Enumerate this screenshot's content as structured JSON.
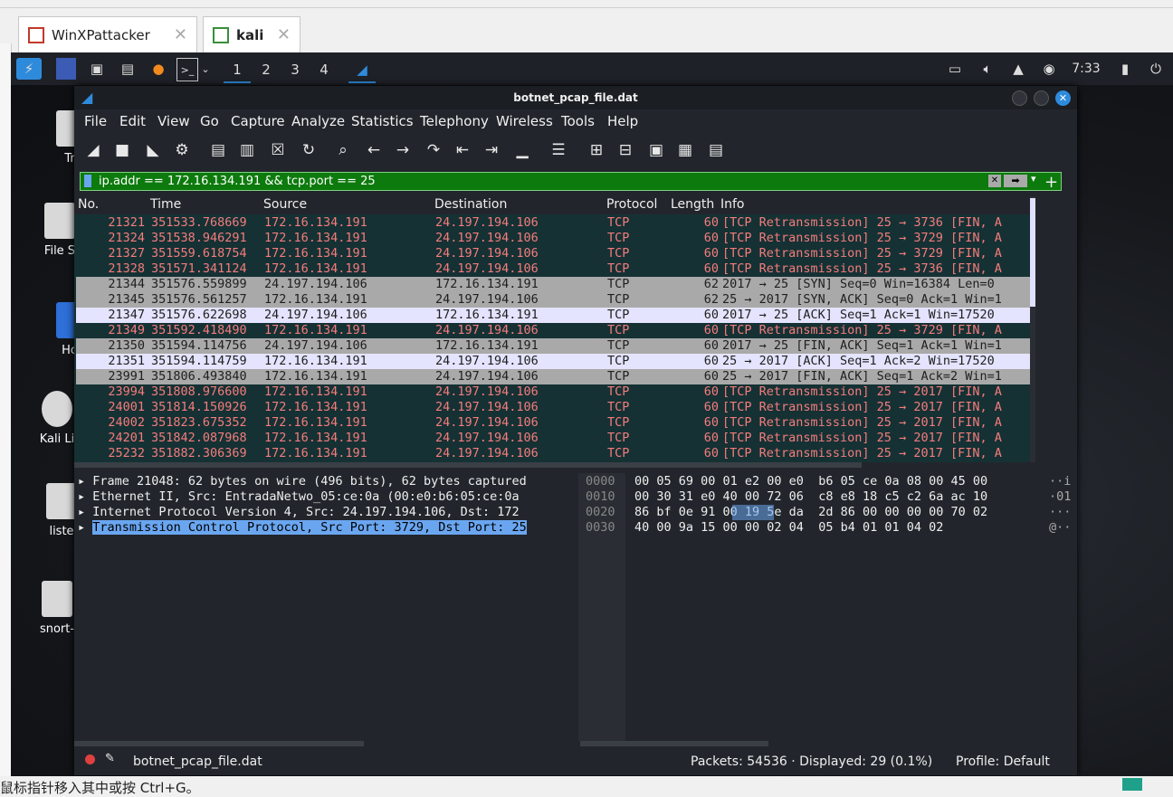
{
  "vm_tabs": [
    {
      "label": "WinXPattacker",
      "close": "✕"
    },
    {
      "label": "kali",
      "close": "✕"
    }
  ],
  "panel": {
    "workspaces": [
      "1",
      "2",
      "3",
      "4"
    ],
    "clock": "7:33"
  },
  "desktop_icons": [
    "Tr",
    "File S",
    "Ho",
    "Kali Li",
    "liste",
    "snort-"
  ],
  "window": {
    "title": "botnet_pcap_file.dat"
  },
  "menu": [
    "File",
    "Edit",
    "View",
    "Go",
    "Capture",
    "Analyze",
    "Statistics",
    "Telephony",
    "Wireless",
    "Tools",
    "Help"
  ],
  "filter": {
    "value": "ip.addr == 172.16.134.191 && tcp.port == 25",
    "plus": "+"
  },
  "columns": {
    "no": "No.",
    "time": "Time",
    "source": "Source",
    "destination": "Destination",
    "protocol": "Protocol",
    "length": "Length",
    "info": "Info"
  },
  "packets": [
    {
      "no": "21321",
      "time": "351533.768669",
      "src": "172.16.134.191",
      "dst": "24.197.194.106",
      "proto": "TCP",
      "len": "60",
      "info": "[TCP Retransmission] 25 → 3736 [FIN, A",
      "style": "dark"
    },
    {
      "no": "21324",
      "time": "351538.946291",
      "src": "172.16.134.191",
      "dst": "24.197.194.106",
      "proto": "TCP",
      "len": "60",
      "info": "[TCP Retransmission] 25 → 3729 [FIN, A",
      "style": "dark"
    },
    {
      "no": "21327",
      "time": "351559.618754",
      "src": "172.16.134.191",
      "dst": "24.197.194.106",
      "proto": "TCP",
      "len": "60",
      "info": "[TCP Retransmission] 25 → 3729 [FIN, A",
      "style": "dark"
    },
    {
      "no": "21328",
      "time": "351571.341124",
      "src": "172.16.134.191",
      "dst": "24.197.194.106",
      "proto": "TCP",
      "len": "60",
      "info": "[TCP Retransmission] 25 → 3736 [FIN, A",
      "style": "dark"
    },
    {
      "no": "21344",
      "time": "351576.559899",
      "src": "24.197.194.106",
      "dst": "172.16.134.191",
      "proto": "TCP",
      "len": "62",
      "info": "2017 → 25 [SYN] Seq=0 Win=16384 Len=0",
      "style": "gray"
    },
    {
      "no": "21345",
      "time": "351576.561257",
      "src": "172.16.134.191",
      "dst": "24.197.194.106",
      "proto": "TCP",
      "len": "62",
      "info": "25 → 2017 [SYN, ACK] Seq=0 Ack=1 Win=1",
      "style": "gray"
    },
    {
      "no": "21347",
      "time": "351576.622698",
      "src": "24.197.194.106",
      "dst": "172.16.134.191",
      "proto": "TCP",
      "len": "60",
      "info": "2017 → 25 [ACK] Seq=1 Ack=1 Win=17520",
      "style": "light"
    },
    {
      "no": "21349",
      "time": "351592.418490",
      "src": "172.16.134.191",
      "dst": "24.197.194.106",
      "proto": "TCP",
      "len": "60",
      "info": "[TCP Retransmission] 25 → 3729 [FIN, A",
      "style": "dark"
    },
    {
      "no": "21350",
      "time": "351594.114756",
      "src": "24.197.194.106",
      "dst": "172.16.134.191",
      "proto": "TCP",
      "len": "60",
      "info": "2017 → 25 [FIN, ACK] Seq=1 Ack=1 Win=1",
      "style": "gray"
    },
    {
      "no": "21351",
      "time": "351594.114759",
      "src": "172.16.134.191",
      "dst": "24.197.194.106",
      "proto": "TCP",
      "len": "60",
      "info": "25 → 2017 [ACK] Seq=1 Ack=2 Win=17520",
      "style": "light"
    },
    {
      "no": "23991",
      "time": "351806.493840",
      "src": "172.16.134.191",
      "dst": "24.197.194.106",
      "proto": "TCP",
      "len": "60",
      "info": "25 → 2017 [FIN, ACK] Seq=1 Ack=2 Win=1",
      "style": "gray"
    },
    {
      "no": "23994",
      "time": "351808.976600",
      "src": "172.16.134.191",
      "dst": "24.197.194.106",
      "proto": "TCP",
      "len": "60",
      "info": "[TCP Retransmission] 25 → 2017 [FIN, A",
      "style": "dark"
    },
    {
      "no": "24001",
      "time": "351814.150926",
      "src": "172.16.134.191",
      "dst": "24.197.194.106",
      "proto": "TCP",
      "len": "60",
      "info": "[TCP Retransmission] 25 → 2017 [FIN, A",
      "style": "dark"
    },
    {
      "no": "24002",
      "time": "351823.675352",
      "src": "172.16.134.191",
      "dst": "24.197.194.106",
      "proto": "TCP",
      "len": "60",
      "info": "[TCP Retransmission] 25 → 2017 [FIN, A",
      "style": "dark"
    },
    {
      "no": "24201",
      "time": "351842.087968",
      "src": "172.16.134.191",
      "dst": "24.197.194.106",
      "proto": "TCP",
      "len": "60",
      "info": "[TCP Retransmission] 25 → 2017 [FIN, A",
      "style": "dark"
    },
    {
      "no": "25232",
      "time": "351882.306369",
      "src": "172.16.134.191",
      "dst": "24.197.194.106",
      "proto": "TCP",
      "len": "60",
      "info": "[TCP Retransmission] 25 → 2017 [FIN, A",
      "style": "dark"
    }
  ],
  "details": [
    {
      "text": "Frame 21048: 62 bytes on wire (496 bits), 62 bytes captured",
      "selected": false
    },
    {
      "text": "Ethernet II, Src: EntradaNetwo_05:ce:0a (00:e0:b6:05:ce:0a",
      "selected": false
    },
    {
      "text": "Internet Protocol Version 4, Src: 24.197.194.106, Dst: 172",
      "selected": false
    },
    {
      "text": "Transmission Control Protocol, Src Port: 3729, Dst Port: 25",
      "selected": true
    }
  ],
  "bytes": [
    {
      "off": "0000",
      "hex": "00 05 69 00 01 e2 00 e0  b6 05 ce 0a 08 00 45 00",
      "ascii": "··i"
    },
    {
      "off": "0010",
      "hex": "00 30 31 e0 40 00 72 06  c8 e8 18 c5 c2 6a ac 10",
      "ascii": "·01"
    },
    {
      "off": "0020",
      "hex": "86 bf 0e 91 00 19 5e da  2d 86 00 00 00 00 70 02",
      "ascii": "···"
    },
    {
      "off": "0030",
      "hex": "40 00 9a 15 00 00 02 04  05 b4 01 01 04 02",
      "ascii": "@··"
    }
  ],
  "status": {
    "file": "botnet_pcap_file.dat",
    "packets": "Packets: 54536 · Displayed: 29 (0.1%)",
    "profile": "Profile: Default"
  },
  "host_status": {
    "text": "鼠标指针移入其中或按 Ctrl+G。"
  },
  "colors": {
    "dark_bg": "#153134",
    "dark_fg": "#f57c7c",
    "gray_bg": "#a9a9a9",
    "gray_fg": "#202020",
    "light_bg": "#e4e4ff",
    "light_fg": "#202020",
    "filter_bg": "#0c7a0c"
  }
}
